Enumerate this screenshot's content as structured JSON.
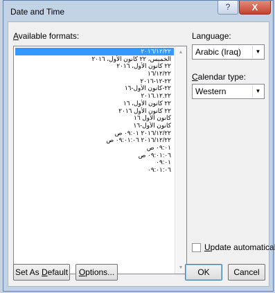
{
  "window": {
    "title": "Date and Time",
    "help_glyph": "?",
    "close_glyph": "X"
  },
  "formats": {
    "label": "Available formats:",
    "items": [
      "٢٠١٦/١٢/٢٢",
      "الخميس، ٢٢ كانون الأول، ٢٠١٦",
      "٢٢ كانون الأول، ٢٠١٦",
      "١٦/١٢/٢٢",
      "٢٢-١٢-٢٠١٦",
      "٢٢-كانون الأول-١٦",
      "٢٠١٦.١٢.٢٢",
      "٢٢ كانون الأول، ١٦",
      "٢٢ كانون الأول ٢٠١٦",
      "كانون الأول ١٦",
      "كانون الأول-١٦",
      "٢٠١٦/١٢/٢٢ ٠٩:٠١ ص",
      "٢٠١٦/١٢/٢٢ ٠٩:٠١:٠٦ ص",
      "٠٩:٠١ ص",
      "٠٩:٠١:٠٦ ص",
      "٠٩:٠١",
      "٠٩:٠١:٠٦"
    ],
    "selected_index": 0
  },
  "language": {
    "label": "Language:",
    "value": "Arabic (Iraq)"
  },
  "calendar": {
    "label": "Calendar type:",
    "value": "Western"
  },
  "update_automatically": {
    "label": "Update automatically",
    "checked": false
  },
  "buttons": {
    "set_default": "Set As Default",
    "options": "Options...",
    "ok": "OK",
    "cancel": "Cancel"
  }
}
